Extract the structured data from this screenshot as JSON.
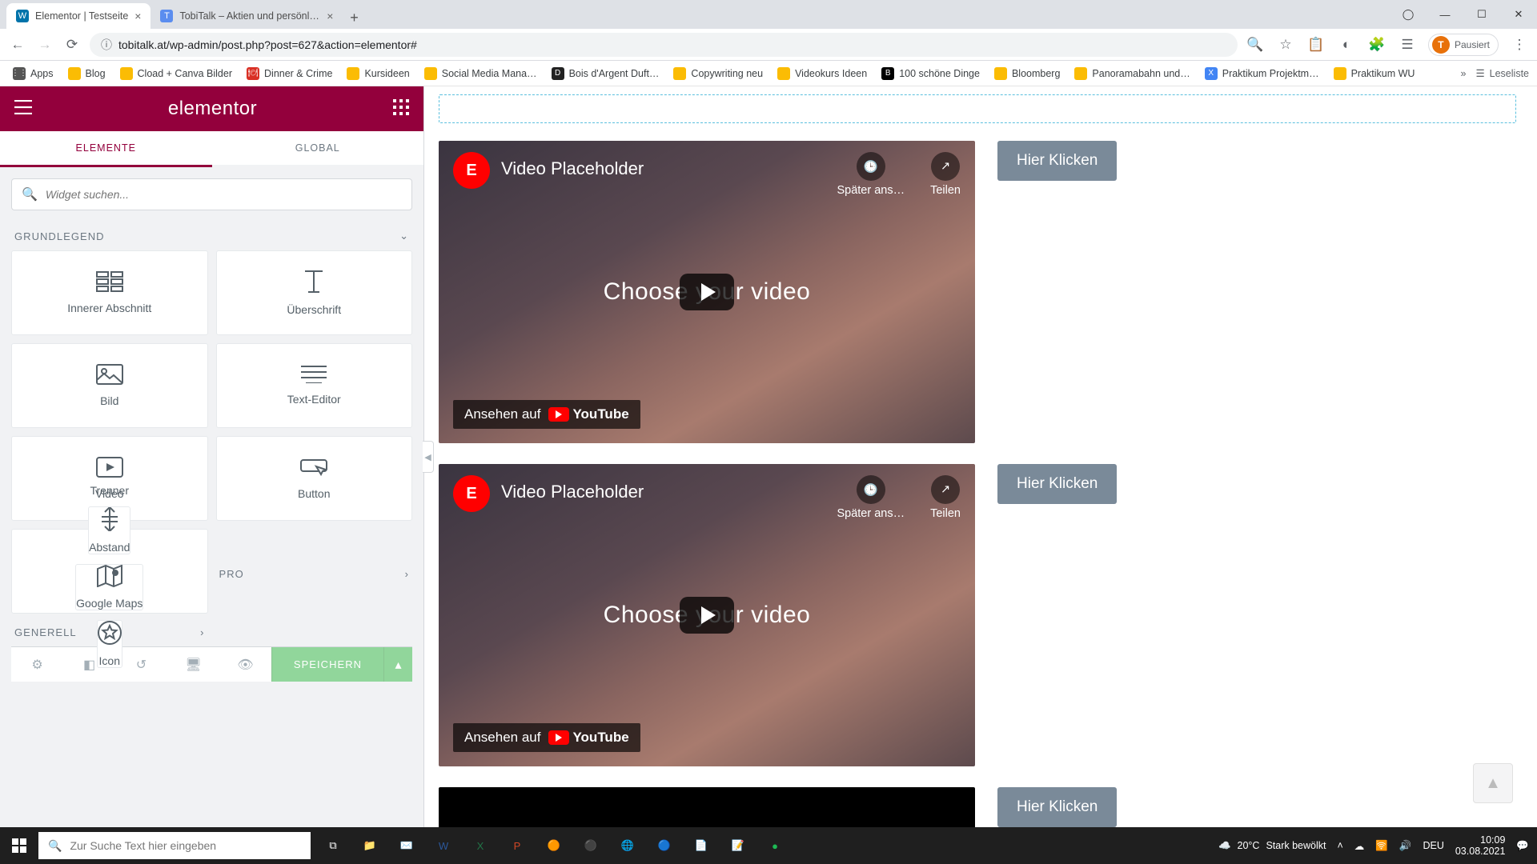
{
  "browser": {
    "tabs": [
      {
        "title": "Elementor | Testseite"
      },
      {
        "title": "TobiTalk – Aktien und persönlich…"
      }
    ],
    "url": "tobitalk.at/wp-admin/post.php?post=627&action=elementor#",
    "avatar_label": "Pausiert",
    "avatar_letter": "T",
    "bookmarks": [
      "Apps",
      "Blog",
      "Cload + Canva Bilder",
      "Dinner & Crime",
      "Kursideen",
      "Social Media Mana…",
      "Bois d'Argent Duft…",
      "Copywriting neu",
      "Videokurs Ideen",
      "100 schöne Dinge",
      "Bloomberg",
      "Panoramabahn und…",
      "Praktikum Projektm…",
      "Praktikum WU"
    ],
    "bookmarks_more": "»",
    "reading_list": "Leseliste"
  },
  "elementor": {
    "brand": "elementor",
    "tabs": {
      "elements": "ELEMENTE",
      "global": "GLOBAL"
    },
    "search_placeholder": "Widget suchen...",
    "categories": {
      "basic": "GRUNDLEGEND",
      "pro": "PRO",
      "general": "GENERELL"
    },
    "widgets": {
      "inner_section": "Innerer Abschnitt",
      "heading": "Überschrift",
      "image": "Bild",
      "text_editor": "Text-Editor",
      "video": "Video",
      "button": "Button",
      "divider": "Trenner",
      "spacer": "Abstand",
      "gmaps": "Google Maps",
      "icon": "Icon"
    },
    "save": "SPEICHERN"
  },
  "canvas": {
    "video_title": "Video Placeholder",
    "watch_later": "Später ans…",
    "share": "Teilen",
    "center_text": "Choose your video",
    "watch_on": "Ansehen auf",
    "youtube": "YouTube",
    "button_label": "Hier Klicken"
  },
  "taskbar": {
    "search_placeholder": "Zur Suche Text hier eingeben",
    "weather_temp": "20°C",
    "weather_text": "Stark bewölkt",
    "lang": "DEU",
    "time": "10:09",
    "date": "03.08.2021"
  }
}
